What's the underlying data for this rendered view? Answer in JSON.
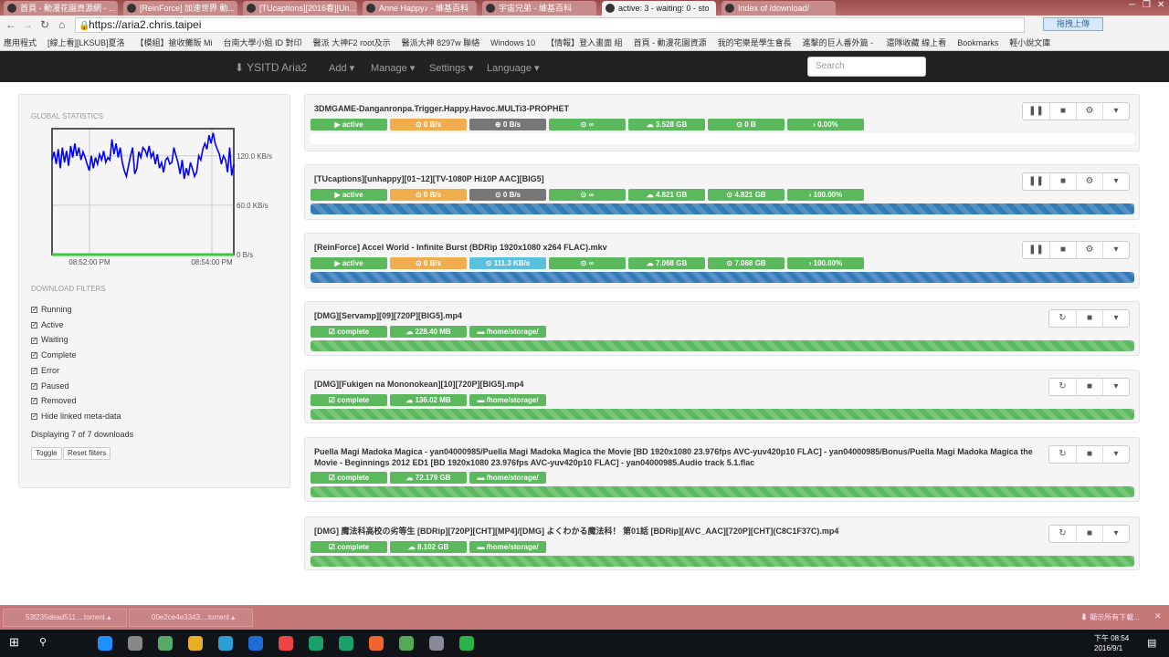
{
  "browser": {
    "tabs": [
      {
        "label": "首頁 - 動漫花園資源網 - ..."
      },
      {
        "label": "[ReinForce] 加速世界 動..."
      },
      {
        "label": "[TUcaptions][2016春][Un..."
      },
      {
        "label": "Anne Happy♪ - 維基百科"
      },
      {
        "label": "宇宙兄弟 - 維基百科"
      },
      {
        "label": "active: 3 - waiting: 0 - sto"
      },
      {
        "label": "Index of /download/"
      }
    ],
    "url": "https://aria2.chris.taipei",
    "upload_ext": "拖拽上傳",
    "bookmarks": [
      "應用程式",
      "[線上看][LKSUB]夏洛",
      "【模組】搶收攤販 Mi",
      "台南大學小姐 ID 對印",
      "醫派 大神F2 root及示",
      "醫派大神 8297w 聯絡",
      "Windows 10",
      "【情報】登入畫面 組",
      "首頁 - 動漫花園資源",
      "我的宅樂是學生會長",
      "進擊的巨人番外篇 - ",
      "還隊收藏 線上看",
      "Bookmarks",
      "輕小說文庫"
    ]
  },
  "navbar": {
    "brand": "YSITD Aria2",
    "menu": [
      "Add",
      "Manage",
      "Settings",
      "Language"
    ],
    "search_placeholder": "Search"
  },
  "sidebar": {
    "stats_title": "GLOBAL STATISTICS",
    "filters_title": "DOWNLOAD FILTERS",
    "filters": [
      {
        "label": "Running",
        "checked": true
      },
      {
        "label": "Active",
        "checked": true
      },
      {
        "label": "Waiting",
        "checked": true
      },
      {
        "label": "Complete",
        "checked": true
      },
      {
        "label": "Error",
        "checked": true
      },
      {
        "label": "Paused",
        "checked": true
      },
      {
        "label": "Removed",
        "checked": true
      },
      {
        "label": "Hide linked meta-data",
        "checked": true
      }
    ],
    "displaying": "Displaying 7 of 7 downloads",
    "toggle": "Toggle",
    "reset": "Reset filters"
  },
  "chart_data": {
    "type": "line",
    "title": "",
    "xlabel": "",
    "ylabel": "",
    "x_ticks": [
      "08:52:00 PM",
      "08:54:00 PM"
    ],
    "y_ticks": [
      "0 B/s",
      "60.0 KB/s",
      "120.0 KB/s"
    ],
    "ylim": [
      0,
      153
    ],
    "series": [
      {
        "name": "download",
        "color": "#0000ff",
        "values": [
          115,
          125,
          110,
          128,
          105,
          130,
          112,
          126,
          108,
          132,
          118,
          135,
          120,
          130,
          115,
          125,
          118,
          110,
          102,
          120,
          105,
          118,
          110,
          122,
          115,
          126,
          112,
          118,
          115,
          140,
          122,
          135,
          118,
          130,
          112,
          102,
          95,
          108,
          120,
          130,
          98,
          104,
          125,
          118,
          130,
          127,
          120,
          132,
          118,
          124,
          110,
          122,
          105,
          112,
          100,
          115,
          118,
          110,
          112,
          130,
          120,
          112,
          98,
          115,
          92,
          105,
          96,
          112,
          104,
          95,
          100,
          120,
          115,
          128,
          135,
          128,
          145,
          135,
          148,
          135,
          128,
          122,
          110,
          120,
          115,
          100,
          130,
          96,
          110
        ]
      },
      {
        "name": "upload",
        "color": "#33cc33",
        "values": [
          0,
          0
        ]
      }
    ]
  },
  "downloads": [
    {
      "name": "3DMGAME-Danganronpa.Trigger.Happy.Havoc.MULTi3-PROPHET",
      "state": "active",
      "badges": [
        [
          "▶ active",
          "#5cb85c"
        ],
        [
          "⊙ 0 B/s",
          "#f0ad4e"
        ],
        [
          "⊕ 0 B/s",
          "#777777"
        ],
        [
          "⊙ ∞",
          "#5cb85c"
        ],
        [
          "☁ 3.528 GB",
          "#5cb85c"
        ],
        [
          "⊙ 0 B",
          "#5cb85c"
        ],
        [
          "› 0.00%",
          "#5cb85c"
        ]
      ],
      "progress": 0,
      "bar_color": "#337ab7",
      "controls": [
        "❚❚",
        "■",
        "⚙",
        "▾"
      ]
    },
    {
      "name": "[TUcaptions][unhappy][01~12][TV-1080P Hi10P AAC][BIG5]",
      "state": "active",
      "badges": [
        [
          "▶ active",
          "#5cb85c"
        ],
        [
          "⊙ 0 B/s",
          "#f0ad4e"
        ],
        [
          "⊙ 0 B/s",
          "#777777"
        ],
        [
          "⊙ ∞",
          "#5cb85c"
        ],
        [
          "☁ 4.821 GB",
          "#5cb85c"
        ],
        [
          "⊙ 4.821 GB",
          "#5cb85c"
        ],
        [
          "› 100.00%",
          "#5cb85c"
        ]
      ],
      "progress": 100,
      "bar_color": "#337ab7",
      "controls": [
        "❚❚",
        "■",
        "⚙",
        "▾"
      ]
    },
    {
      "name": "[ReinForce] Accel World - Infinite Burst (BDRip 1920x1080 x264 FLAC).mkv",
      "state": "active",
      "badges": [
        [
          "▶ active",
          "#5cb85c"
        ],
        [
          "⊙ 0 B/s",
          "#f0ad4e"
        ],
        [
          "⊙ 111.3 KB/s",
          "#5bc0de"
        ],
        [
          "⊙ ∞",
          "#5cb85c"
        ],
        [
          "☁ 7.068 GB",
          "#5cb85c"
        ],
        [
          "⊙ 7.068 GB",
          "#5cb85c"
        ],
        [
          "› 100.00%",
          "#5cb85c"
        ]
      ],
      "progress": 100,
      "bar_color": "#337ab7",
      "controls": [
        "❚❚",
        "■",
        "⚙",
        "▾"
      ]
    },
    {
      "name": "[DMG][Servamp][09][720P][BIG5].mp4",
      "state": "complete",
      "badges": [
        [
          "☑ complete",
          "#5cb85c"
        ],
        [
          "☁ 228.40 MB",
          "#5cb85c"
        ],
        [
          "▬ /home/storage/",
          "#5cb85c"
        ]
      ],
      "progress": 100,
      "bar_color": "#5cb85c",
      "controls": [
        "↻",
        "■",
        "▾"
      ]
    },
    {
      "name": "[DMG][Fukigen na Mononokean][10][720P][BIG5].mp4",
      "state": "complete",
      "badges": [
        [
          "☑ complete",
          "#5cb85c"
        ],
        [
          "☁ 136.02 MB",
          "#5cb85c"
        ],
        [
          "▬ /home/storage/",
          "#5cb85c"
        ]
      ],
      "progress": 100,
      "bar_color": "#5cb85c",
      "controls": [
        "↻",
        "■",
        "▾"
      ]
    },
    {
      "name": "Puella Magi Madoka Magica - yan04000985/Puella Magi Madoka Magica the Movie [BD 1920x1080 23.976fps AVC-yuv420p10 FLAC] - yan04000985/Bonus/Puella Magi Madoka Magica the Movie - Beginnings 2012 ED1 [BD 1920x1080 23.976fps AVC-yuv420p10 FLAC] - yan04000985.Audio track 5.1.flac",
      "state": "complete",
      "badges": [
        [
          "☑ complete",
          "#5cb85c"
        ],
        [
          "☁ 72.179 GB",
          "#5cb85c"
        ],
        [
          "▬ /home/storage/",
          "#5cb85c"
        ]
      ],
      "progress": 100,
      "bar_color": "#5cb85c",
      "controls": [
        "↻",
        "■",
        "▾"
      ]
    },
    {
      "name": "[DMG] 魔法科高校の劣等生 [BDRip][720P][CHT][MP4]/[DMG] よくわかる魔法科！ 第01話 [BDRip][AVC_AAC][720P][CHT](C8C1F37C).mp4",
      "state": "complete",
      "badges": [
        [
          "☑ complete",
          "#5cb85c"
        ],
        [
          "☁ 8.102 GB",
          "#5cb85c"
        ],
        [
          "▬ /home/storage/",
          "#5cb85c"
        ]
      ],
      "progress": 100,
      "bar_color": "#5cb85c",
      "controls": [
        "↻",
        "■",
        "▾"
      ]
    }
  ],
  "download_shelf": {
    "items": [
      "53f235dead511....torrent",
      "00e2ce4e3343....torrent"
    ],
    "show_all": "顯示所有下載..."
  },
  "taskbar": {
    "time": "下午 08:54",
    "date": "2016/9/1"
  }
}
